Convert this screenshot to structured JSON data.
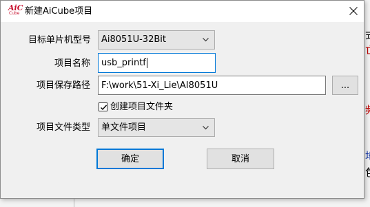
{
  "dialog": {
    "title": "新建AiCube项目",
    "logo_text_top": "AiC",
    "logo_text_bottom": "Cube",
    "close_icon": "close-icon"
  },
  "form": {
    "model_label": "目标单片机型号",
    "model_value": "Ai8051U-32Bit",
    "name_label": "项目名称",
    "name_value": "usb_printf",
    "path_label": "项目保存路径",
    "path_value": "F:\\work\\51-Xi_Lie\\AI8051U",
    "browse_label": "...",
    "create_folder_label": "创建项目文件夹",
    "create_folder_checked": true,
    "type_label": "项目文件类型",
    "type_value": "单文件项目"
  },
  "buttons": {
    "ok_label": "确定",
    "cancel_label": "取消"
  },
  "background": {
    "glyphs": [
      "式",
      "亡",
      "频",
      "地",
      "包"
    ]
  },
  "colors": {
    "focus_border": "#0078d7",
    "logo_red": "#c8102e",
    "dialog_bg": "#f0f0f0"
  }
}
